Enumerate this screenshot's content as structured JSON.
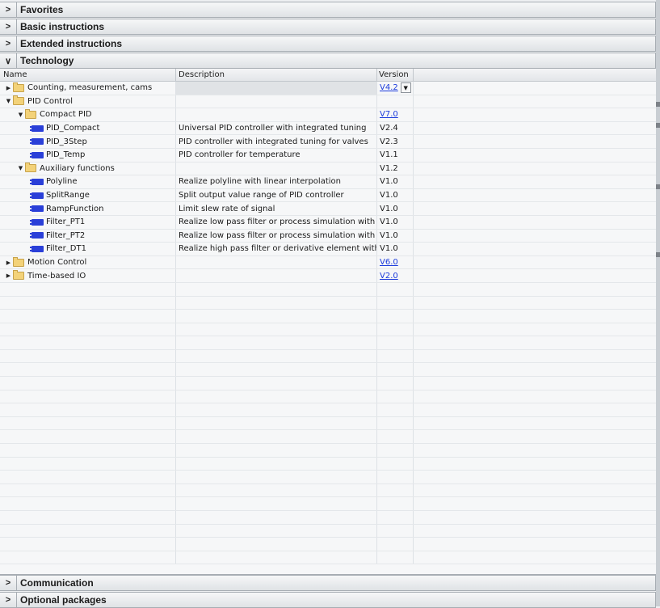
{
  "sections_top": [
    {
      "label": "Favorites",
      "state": "collapsed"
    },
    {
      "label": "Basic instructions",
      "state": "collapsed"
    },
    {
      "label": "Extended instructions",
      "state": "collapsed"
    },
    {
      "label": "Technology",
      "state": "expanded"
    }
  ],
  "sections_bottom": [
    {
      "label": "Communication",
      "state": "collapsed"
    },
    {
      "label": "Optional packages",
      "state": "collapsed"
    }
  ],
  "columns": {
    "name": "Name",
    "description": "Description",
    "version": "Version"
  },
  "rows": [
    {
      "depth": 0,
      "expander": "collapsed",
      "icon": "folder-icon",
      "name": "Counting, measurement, cams",
      "description": "",
      "version": "V4.2",
      "version_link": true,
      "dropdown": true,
      "selected": true
    },
    {
      "depth": 0,
      "expander": "expanded",
      "icon": "folder-icon",
      "name": "PID Control",
      "description": "",
      "version": ""
    },
    {
      "depth": 1,
      "expander": "expanded",
      "icon": "folder-icon",
      "name": "Compact PID",
      "description": "",
      "version": "V7.0",
      "version_link": true
    },
    {
      "depth": 2,
      "expander": "none",
      "icon": "function-block-icon",
      "name": "PID_Compact",
      "description": "Universal PID controller with integrated tuning",
      "version": "V2.4"
    },
    {
      "depth": 2,
      "expander": "none",
      "icon": "function-block-icon",
      "name": "PID_3Step",
      "description": "PID controller with integrated tuning for valves",
      "version": "V2.3"
    },
    {
      "depth": 2,
      "expander": "none",
      "icon": "function-block-icon",
      "name": "PID_Temp",
      "description": "PID controller for temperature",
      "version": "V1.1"
    },
    {
      "depth": 1,
      "expander": "expanded",
      "icon": "folder-icon",
      "name": "Auxiliary functions",
      "description": "",
      "version": "V1.2"
    },
    {
      "depth": 2,
      "expander": "none",
      "icon": "function-block-icon",
      "name": "Polyline",
      "description": "Realize polyline with linear interpolation",
      "version": "V1.0"
    },
    {
      "depth": 2,
      "expander": "none",
      "icon": "function-block-icon",
      "name": "SplitRange",
      "description": "Split output value range of PID controller",
      "version": "V1.0"
    },
    {
      "depth": 2,
      "expander": "none",
      "icon": "function-block-icon",
      "name": "RampFunction",
      "description": "Limit slew rate of signal",
      "version": "V1.0"
    },
    {
      "depth": 2,
      "expander": "none",
      "icon": "function-block-icon",
      "name": "Filter_PT1",
      "description": "Realize low pass filter or process simulation with fir.",
      "version": "V1.0"
    },
    {
      "depth": 2,
      "expander": "none",
      "icon": "function-block-icon",
      "name": "Filter_PT2",
      "description": "Realize low pass filter or process simulation with se",
      "version": "V1.0"
    },
    {
      "depth": 2,
      "expander": "none",
      "icon": "function-block-icon",
      "name": "Filter_DT1",
      "description": "Realize high pass filter or derivative element with fi.",
      "version": "V1.0"
    },
    {
      "depth": 0,
      "expander": "collapsed",
      "icon": "folder-icon",
      "name": "Motion Control",
      "description": "",
      "version": "V6.0",
      "version_link": true
    },
    {
      "depth": 0,
      "expander": "collapsed",
      "icon": "folder-icon",
      "name": "Time-based IO",
      "description": "",
      "version": "V2.0",
      "version_link": true
    }
  ],
  "colors": {
    "link": "#1b3bdc",
    "function_block": "#2a3fd8",
    "folder": "#f3d279",
    "panel_bg": "#f6f7f8"
  }
}
